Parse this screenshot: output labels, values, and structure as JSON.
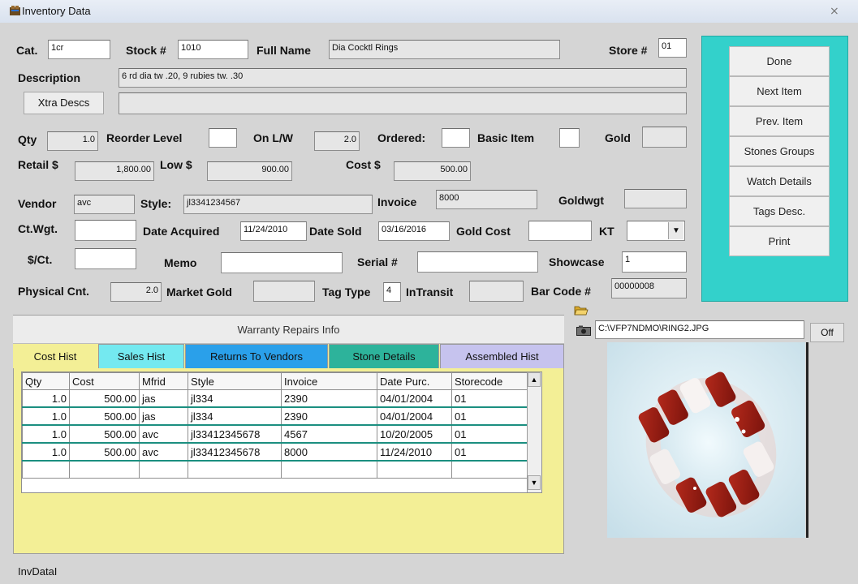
{
  "window": {
    "title": "Inventory Data",
    "close_glyph": "⨯"
  },
  "fields": {
    "cat": {
      "label": "Cat.",
      "value": "1cr"
    },
    "stock": {
      "label": "Stock #",
      "value": "1010"
    },
    "full_name": {
      "label": "Full Name",
      "value": "Dia Cocktl Rings"
    },
    "store": {
      "label": "Store #",
      "value": "01"
    },
    "description": {
      "label": "Description",
      "value": "6 rd dia tw .20, 9 rubies tw. .30"
    },
    "xtra_desc": {
      "button": "Xtra Descs",
      "value": ""
    },
    "qty": {
      "label": "Qty",
      "value": "1.0"
    },
    "reorder": {
      "label": "Reorder Level",
      "value": ""
    },
    "on_lw": {
      "label": "On L/W",
      "value": "2.0"
    },
    "ordered": {
      "label": "Ordered:",
      "value": ""
    },
    "basic_item": {
      "label": "Basic Item",
      "value": ""
    },
    "gold": {
      "label": "Gold",
      "value": ""
    },
    "retail": {
      "label": "Retail $",
      "value": "1,800.00"
    },
    "low": {
      "label": "Low $",
      "value": "900.00"
    },
    "cost": {
      "label": "Cost $",
      "value": "500.00"
    },
    "vendor": {
      "label": "Vendor",
      "value": "avc"
    },
    "style": {
      "label": "Style:",
      "value": "jl3341234567"
    },
    "invoice": {
      "label": "Invoice",
      "value": "8000"
    },
    "goldwgt": {
      "label": "Goldwgt",
      "value": ""
    },
    "ctwgt": {
      "label": "Ct.Wgt.",
      "value": ""
    },
    "date_acquired": {
      "label": "Date Acquired",
      "value": "11/24/2010"
    },
    "date_sold": {
      "label": "Date Sold",
      "value": "03/16/2016"
    },
    "gold_cost": {
      "label": "Gold Cost",
      "value": ""
    },
    "kt": {
      "label": "KT",
      "value": ""
    },
    "per_ct": {
      "label": "$/Ct.",
      "value": ""
    },
    "memo": {
      "label": "Memo",
      "value": ""
    },
    "serial": {
      "label": "Serial #",
      "value": ""
    },
    "showcase": {
      "label": "Showcase",
      "value": "1"
    },
    "physical_cnt": {
      "label": "Physical Cnt.",
      "value": "2.0"
    },
    "market_gold": {
      "label": "Market Gold",
      "value": ""
    },
    "tag_type": {
      "label": "Tag Type",
      "value": "4"
    },
    "in_transit": {
      "label": "InTransit",
      "value": ""
    },
    "bar_code": {
      "label": "Bar Code #",
      "value": "00000008"
    }
  },
  "side_buttons": [
    "Done",
    "Next Item",
    "Prev. Item",
    "Stones Groups",
    "Watch Details",
    "Tags Desc.",
    "Print"
  ],
  "history": {
    "header": "Warranty Repairs Info",
    "tabs": [
      "Cost Hist",
      "Sales Hist",
      "Returns To Vendors",
      "Stone Details",
      "Assembled Hist"
    ],
    "columns": [
      "Qty",
      "Cost",
      "Mfrid",
      "Style",
      "Invoice",
      "Date Purc.",
      "Storecode"
    ],
    "rows": [
      [
        "1.0",
        "500.00",
        "jas",
        "jl334",
        "2390",
        "04/01/2004",
        "01"
      ],
      [
        "1.0",
        "500.00",
        "jas",
        "jl334",
        "2390",
        "04/01/2004",
        "01"
      ],
      [
        "1.0",
        "500.00",
        "avc",
        "jl33412345678",
        "4567",
        "10/20/2005",
        "01"
      ],
      [
        "1.0",
        "500.00",
        "avc",
        "jl33412345678",
        "8000",
        "11/24/2010",
        "01"
      ]
    ]
  },
  "image": {
    "path": "C:\\VFP7NDMO\\RING2.JPG",
    "off_label": "Off"
  },
  "status": {
    "form_name": "InvDataI"
  },
  "colors": {
    "panel": "#33d1cb",
    "tab_active": "#f3ef96",
    "tab_sales": "#74e9f0",
    "tab_returns": "#2aa0ea",
    "tab_stone": "#2db39b",
    "tab_assembled": "#c6c3ee"
  }
}
